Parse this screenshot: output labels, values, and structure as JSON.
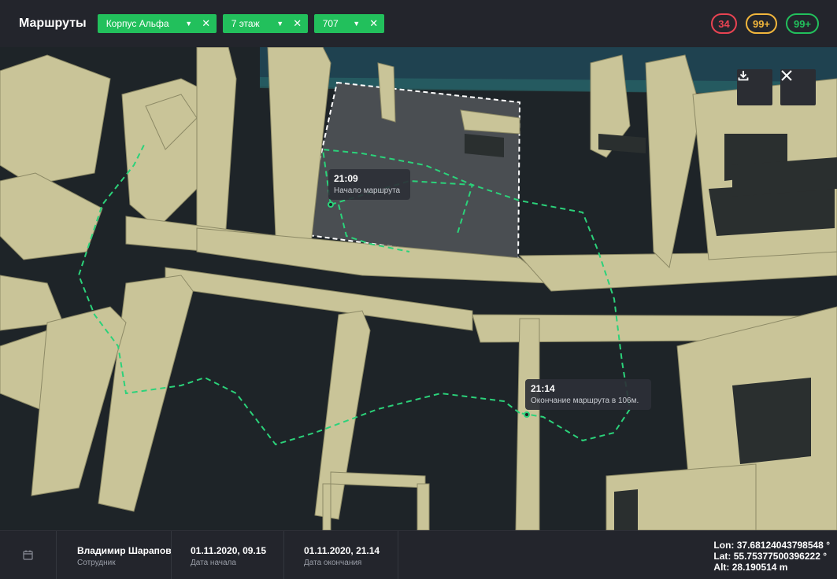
{
  "header": {
    "title": "Маршруты",
    "filters": [
      {
        "label": "Корпус Альфа"
      },
      {
        "label": "7 этаж"
      },
      {
        "label": "707"
      }
    ],
    "badges": [
      {
        "value": "34",
        "color": "#e84352"
      },
      {
        "value": "99+",
        "color": "#f2b63c"
      },
      {
        "value": "99+",
        "color": "#22c05c"
      }
    ]
  },
  "map": {
    "download_icon": "download-icon",
    "close_icon": "close-icon",
    "route_color": "#2bd27a",
    "start": {
      "time": "21:09",
      "label": "Начало маршрута"
    },
    "end": {
      "time": "21:14",
      "label": "Окончание маршрута в 106м."
    }
  },
  "footer": {
    "calendar_icon": "calendar-icon",
    "employee": {
      "value": "Владимир Шарапов",
      "label": "Сотрудник"
    },
    "start_date": {
      "value": "01.11.2020, 09.15",
      "label": "Дата начала"
    },
    "end_date": {
      "value": "01.11.2020, 21.14",
      "label": "Дата окончания"
    },
    "coords": {
      "lon": "Lon: 37.68124043798548 °",
      "lat": "Lat: 55.75377500396222 °",
      "alt": "Alt: 28.190514 m"
    }
  }
}
